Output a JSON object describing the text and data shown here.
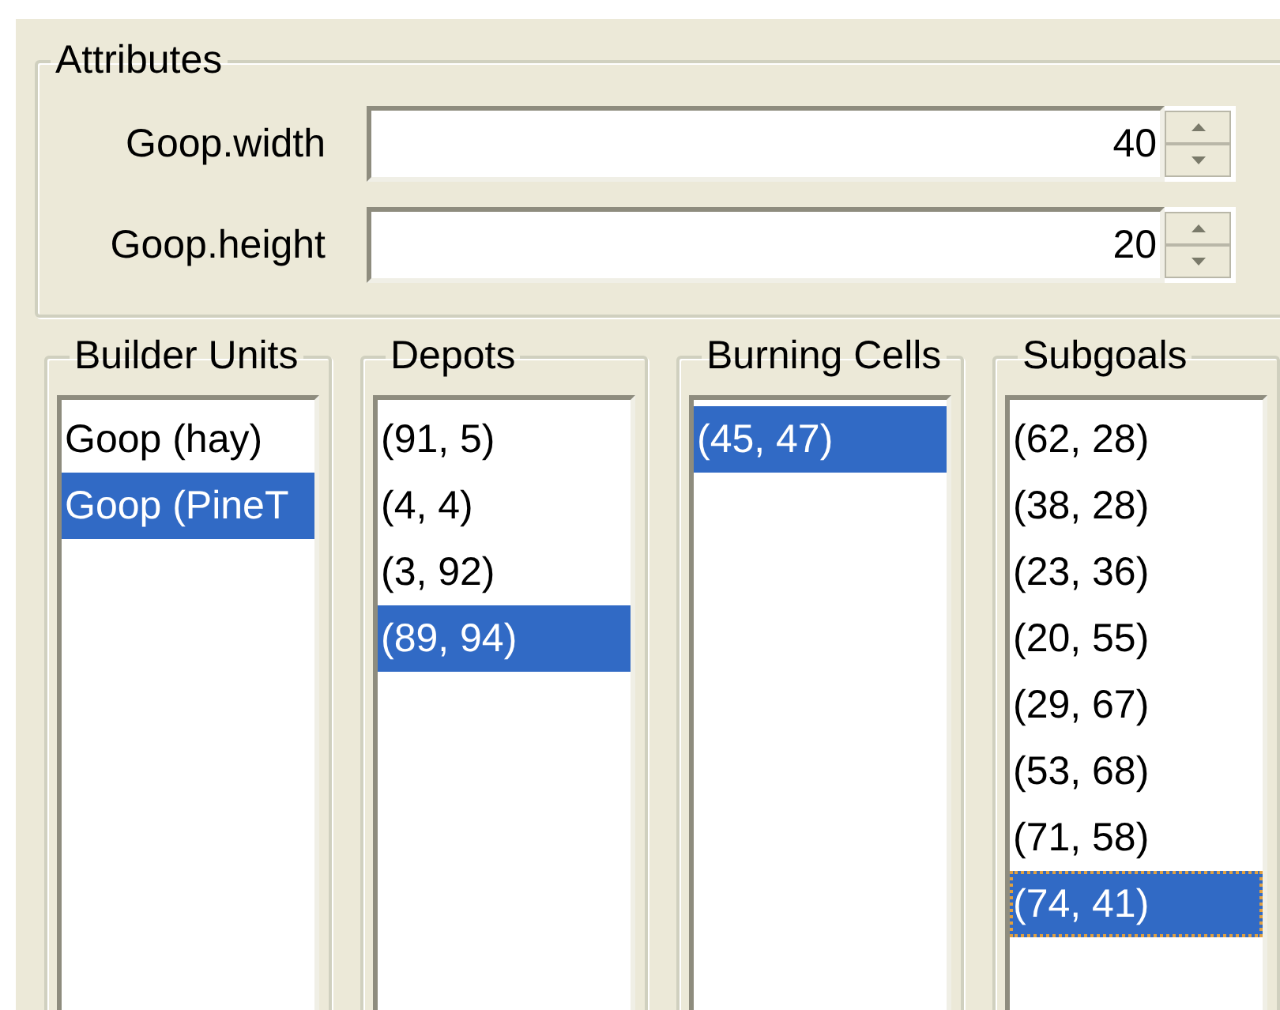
{
  "attributes": {
    "title": "Attributes",
    "fields": [
      {
        "label": "Goop.width",
        "value": "40"
      },
      {
        "label": "Goop.height",
        "value": "20"
      }
    ]
  },
  "lists": [
    {
      "title": "Builder Units",
      "items": [
        {
          "text": "Goop (hay)",
          "selected": false,
          "focused": false
        },
        {
          "text": "Goop (PineT",
          "selected": true,
          "focused": false
        }
      ]
    },
    {
      "title": "Depots",
      "items": [
        {
          "text": "(91, 5)",
          "selected": false,
          "focused": false
        },
        {
          "text": "(4, 4)",
          "selected": false,
          "focused": false
        },
        {
          "text": "(3, 92)",
          "selected": false,
          "focused": false
        },
        {
          "text": "(89, 94)",
          "selected": true,
          "focused": false
        }
      ]
    },
    {
      "title": "Burning Cells",
      "items": [
        {
          "text": "(45, 47)",
          "selected": true,
          "focused": false
        }
      ]
    },
    {
      "title": "Subgoals",
      "items": [
        {
          "text": "(62, 28)",
          "selected": false,
          "focused": false
        },
        {
          "text": "(38, 28)",
          "selected": false,
          "focused": false
        },
        {
          "text": "(23, 36)",
          "selected": false,
          "focused": false
        },
        {
          "text": "(20, 55)",
          "selected": false,
          "focused": false
        },
        {
          "text": "(29, 67)",
          "selected": false,
          "focused": false
        },
        {
          "text": "(53, 68)",
          "selected": false,
          "focused": false
        },
        {
          "text": "(71, 58)",
          "selected": false,
          "focused": false
        },
        {
          "text": "(74, 41)",
          "selected": true,
          "focused": true
        }
      ]
    }
  ]
}
